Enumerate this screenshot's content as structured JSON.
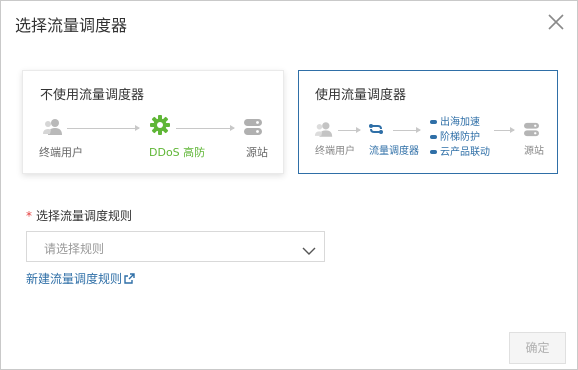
{
  "dialog": {
    "title": "选择流量调度器",
    "close_icon": "close-icon"
  },
  "cards": {
    "without": {
      "title": "不使用流量调度器",
      "nodes": [
        {
          "label": "终端用户",
          "icon": "user-icon"
        },
        {
          "label": "DDoS 高防",
          "icon": "gear-icon",
          "color": "#5fb636"
        },
        {
          "label": "源站",
          "icon": "server-icon"
        }
      ]
    },
    "with": {
      "title": "使用流量调度器",
      "nodes": [
        {
          "label": "终端用户",
          "icon": "user-icon"
        },
        {
          "label": "流量调度器",
          "icon": "scheduler-icon",
          "color": "#2f6fa7"
        },
        {
          "label": "源站",
          "icon": "server-icon"
        }
      ],
      "features": [
        "出海加速",
        "阶梯防护",
        "云产品联动"
      ]
    }
  },
  "rule": {
    "required_mark": "*",
    "label": "选择流量调度规则",
    "placeholder": "请选择规则",
    "dropdown_icon": "chevron-down-icon"
  },
  "new_rule_link": {
    "label": "新建流量调度规则",
    "icon": "external-link-icon"
  },
  "footer": {
    "confirm_label": "确定"
  },
  "colors": {
    "accent": "#2f6fa7",
    "green": "#5fb636",
    "required": "#e53e3e"
  }
}
